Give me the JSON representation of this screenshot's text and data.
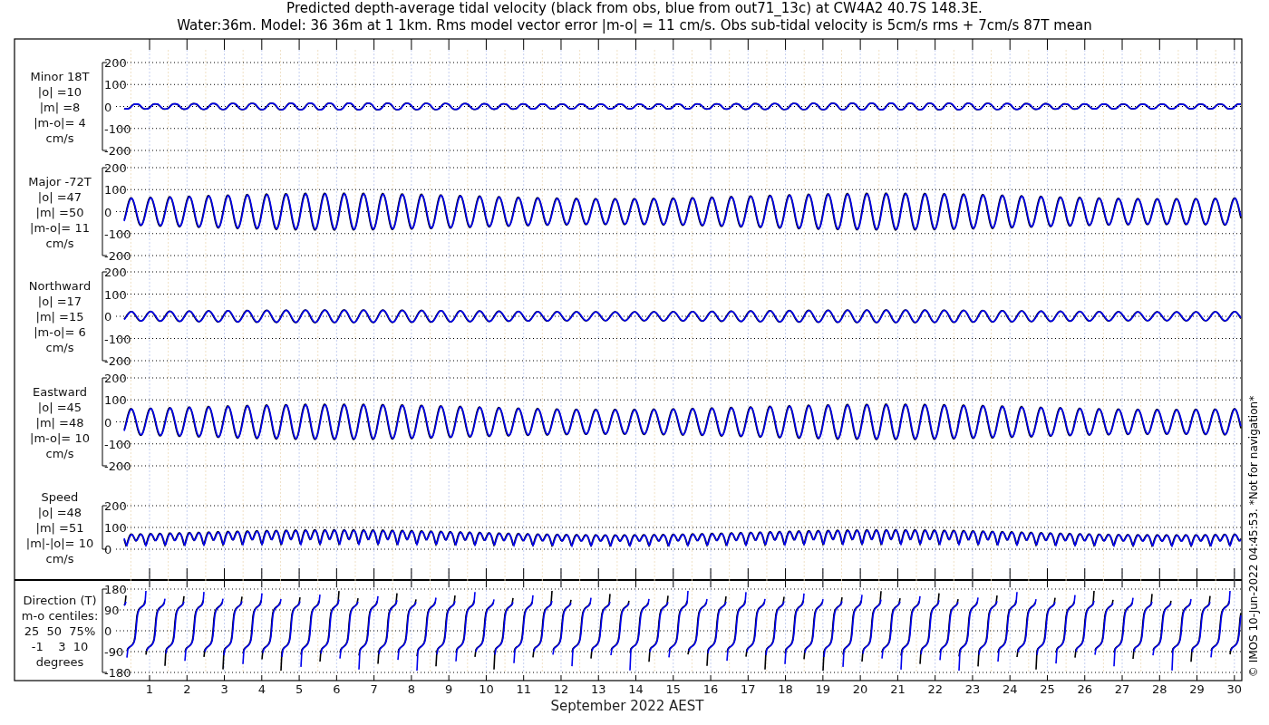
{
  "title": [
    "Predicted depth-average tidal velocity (black from obs, blue from out71_13c) at CW4A2 40.7S 148.3E.",
    "Water:36m. Model: 36 36m at 1 1km. Rms model vector error |m-o| = 11 cm/s. Obs sub-tidal velocity is 5cm/s rms + 7cm/s 87T mean"
  ],
  "panels": [
    {
      "kind": "velocity",
      "label_lines": [
        "Minor 18T",
        "|o| =10",
        "|m| =8",
        "|m-o|= 4",
        "cm/s"
      ],
      "yticks": [
        "200",
        "100",
        "0",
        "-100",
        "-200"
      ]
    },
    {
      "kind": "velocity",
      "label_lines": [
        "Major -72T",
        "|o| =47",
        "|m| =50",
        "|m-o|= 11",
        "cm/s"
      ],
      "yticks": [
        "200",
        "100",
        "0",
        "-100",
        "-200"
      ]
    },
    {
      "kind": "velocity",
      "label_lines": [
        "Northward",
        "|o| =17",
        "|m| =15",
        "|m-o|= 6",
        "cm/s"
      ],
      "yticks": [
        "200",
        "100",
        "0",
        "-100",
        "-200"
      ]
    },
    {
      "kind": "velocity",
      "label_lines": [
        "Eastward",
        "|o| =45",
        "|m| =48",
        "|m-o|= 10",
        "cm/s"
      ],
      "yticks": [
        "200",
        "100",
        "0",
        "-100",
        "-200"
      ]
    },
    {
      "kind": "speed",
      "label_lines": [
        "Speed",
        "|o| =48",
        "|m| =51",
        "|m|-|o|= 10",
        "cm/s"
      ],
      "yticks": [
        "200",
        "100",
        "0"
      ]
    },
    {
      "kind": "direction",
      "label_lines": [
        "Direction (T)",
        "m-o centiles:",
        "25  50  75%",
        "-1    3  10",
        "degrees"
      ],
      "yticks": [
        "180",
        "90",
        "0",
        "-90",
        "-180"
      ]
    }
  ],
  "x_axis": {
    "ticks": [
      "1",
      "2",
      "3",
      "4",
      "5",
      "6",
      "7",
      "8",
      "9",
      "10",
      "11",
      "12",
      "13",
      "14",
      "15",
      "16",
      "17",
      "18",
      "19",
      "20",
      "21",
      "22",
      "23",
      "24",
      "25",
      "26",
      "27",
      "28",
      "29",
      "30"
    ],
    "label": "September 2022 AEST"
  },
  "footer": "© IMOS 10-Jun-2022 04:45:53. *Not for navigation*"
}
